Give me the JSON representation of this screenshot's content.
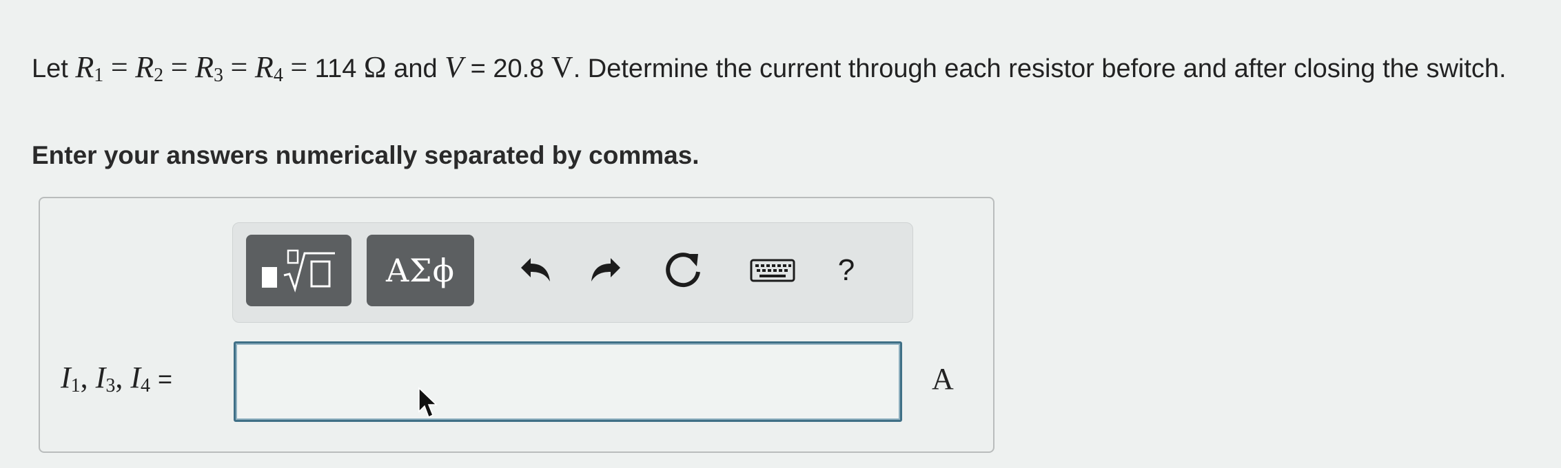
{
  "problem": {
    "let": "Let",
    "r1": "R",
    "r1_sub": "1",
    "r2": "R",
    "r2_sub": "2",
    "r3": "R",
    "r3_sub": "3",
    "r4": "R",
    "r4_sub": "4",
    "equals": "=",
    "resistance_value": "114",
    "ohm_symbol": "Ω",
    "and": "and",
    "v": "V",
    "voltage_value": "20.8",
    "volt_unit": "V",
    "rest": ". Determine the current through each resistor before and after closing the switch."
  },
  "instruction": "Enter your answers numerically separated by commas.",
  "toolbar": {
    "templates_icon": "templates-icon",
    "symbols_label": "ΑΣϕ",
    "undo_icon": "undo-icon",
    "redo_icon": "redo-icon",
    "reset_icon": "reset-icon",
    "keyboard_icon": "keyboard-icon",
    "help_label": "?"
  },
  "answer": {
    "label_i1": "I",
    "sub1": "1",
    "label_i3": "I",
    "sub3": "3",
    "label_i4": "I",
    "sub4": "4",
    "separator": ",",
    "equals": "=",
    "value": "",
    "unit": "A"
  },
  "colors": {
    "background": "#eef1f0",
    "toolbar_button": "#5c5f61",
    "input_border": "#3f6f86"
  }
}
